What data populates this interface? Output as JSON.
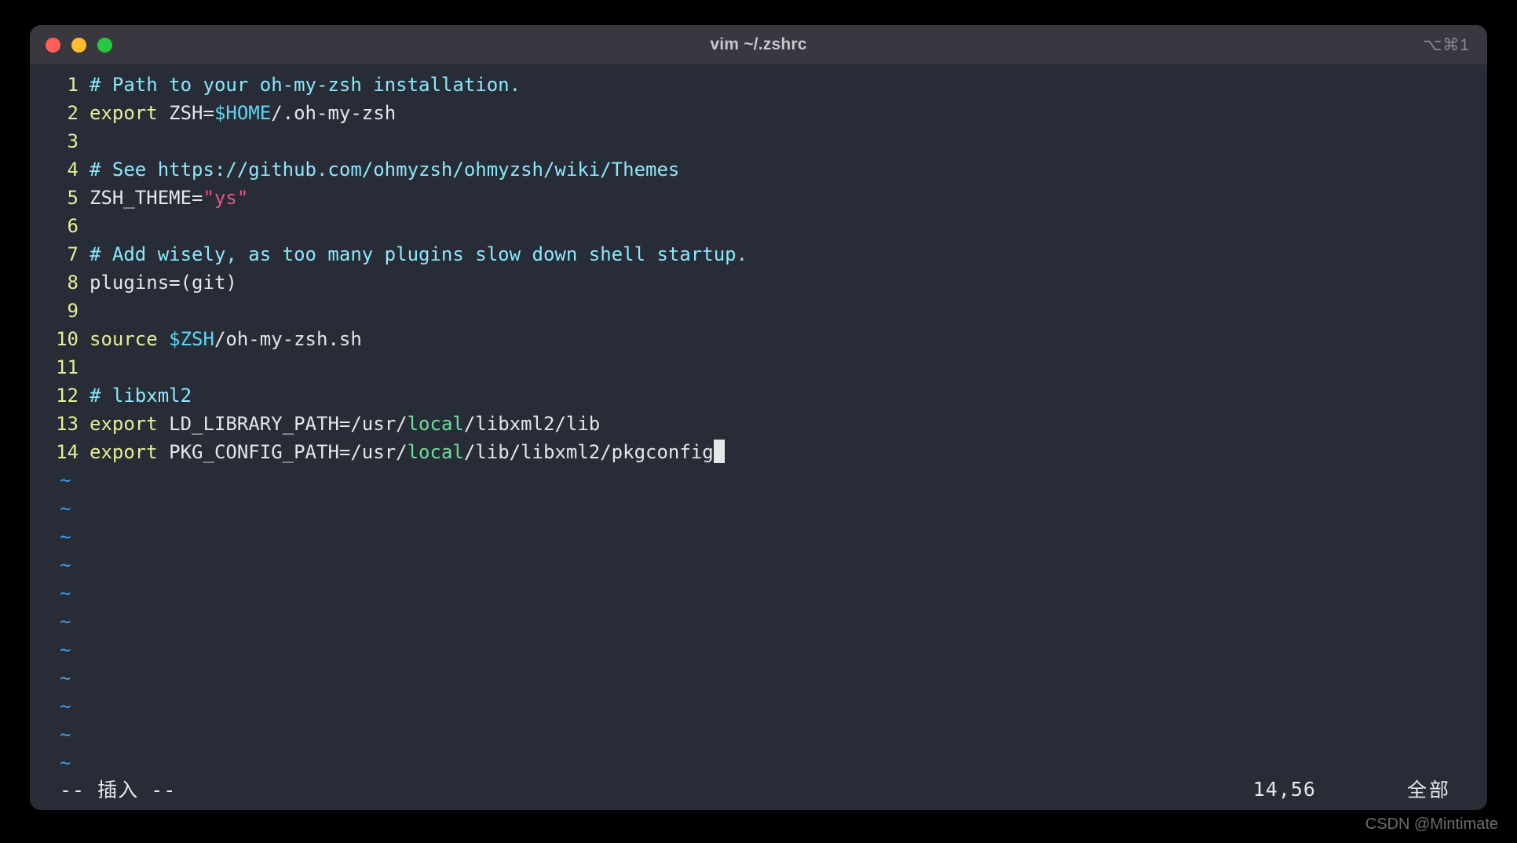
{
  "window": {
    "title": "vim ~/.zshrc",
    "shortcut_hint": "⌥⌘1",
    "traffic_lights": {
      "close_label": "close",
      "minimize_label": "minimize",
      "maximize_label": "maximize",
      "close_color": "#ff5f57",
      "minimize_color": "#febc2e",
      "maximize_color": "#28c840"
    },
    "titlebar_color": "#393740",
    "editor_bg_color": "#282c36"
  },
  "editor": {
    "filename": "~/.zshrc",
    "colors": {
      "line_number": "#e7ee98",
      "comment": "#8be9fd",
      "keyword": "#e7ee98",
      "variable": "#61d6f5",
      "string": "#ee4f8d",
      "directory": "#6cdf9a",
      "plain_text": "#d8dee9",
      "tilde": "#3f9bee",
      "cursor": "#e7e7e7"
    },
    "lines": [
      {
        "number": "1",
        "text": "# Path to your oh-my-zsh installation.",
        "tokens": [
          {
            "t": "# Path to your oh-my-zsh installation.",
            "c": "c-comment"
          }
        ]
      },
      {
        "number": "2",
        "text": "export ZSH=$HOME/.oh-my-zsh",
        "tokens": [
          {
            "t": "export ",
            "c": "c-keyword"
          },
          {
            "t": "ZSH=",
            "c": "c-plain"
          },
          {
            "t": "$HOME",
            "c": "c-var"
          },
          {
            "t": "/.oh-my-zsh",
            "c": "c-plain"
          }
        ]
      },
      {
        "number": "3",
        "text": "",
        "tokens": []
      },
      {
        "number": "4",
        "text": "# See https://github.com/ohmyzsh/ohmyzsh/wiki/Themes",
        "tokens": [
          {
            "t": "# See https://github.com/ohmyzsh/ohmyzsh/wiki/Themes",
            "c": "c-comment"
          }
        ]
      },
      {
        "number": "5",
        "text": "ZSH_THEME=\"ys\"",
        "tokens": [
          {
            "t": "ZSH_THEME=",
            "c": "c-plain"
          },
          {
            "t": "\"ys\"",
            "c": "c-string"
          }
        ]
      },
      {
        "number": "6",
        "text": "",
        "tokens": []
      },
      {
        "number": "7",
        "text": "# Add wisely, as too many plugins slow down shell startup.",
        "tokens": [
          {
            "t": "# Add wisely, as too many plugins slow down shell startup.",
            "c": "c-comment"
          }
        ]
      },
      {
        "number": "8",
        "text": "plugins=(git)",
        "tokens": [
          {
            "t": "plugins=(git)",
            "c": "c-plain"
          }
        ]
      },
      {
        "number": "9",
        "text": "",
        "tokens": []
      },
      {
        "number": "10",
        "text": "source $ZSH/oh-my-zsh.sh",
        "tokens": [
          {
            "t": "source ",
            "c": "c-keyword"
          },
          {
            "t": "$ZSH",
            "c": "c-var"
          },
          {
            "t": "/oh-my-zsh.sh",
            "c": "c-plain"
          }
        ]
      },
      {
        "number": "11",
        "text": "",
        "tokens": []
      },
      {
        "number": "12",
        "text": "# libxml2",
        "tokens": [
          {
            "t": "# libxml2",
            "c": "c-comment"
          }
        ]
      },
      {
        "number": "13",
        "text": "export LD_LIBRARY_PATH=/usr/local/libxml2/lib",
        "tokens": [
          {
            "t": "export ",
            "c": "c-keyword"
          },
          {
            "t": "LD_LIBRARY_PATH=/usr/",
            "c": "c-plain"
          },
          {
            "t": "local",
            "c": "c-dir"
          },
          {
            "t": "/libxml2/lib",
            "c": "c-plain"
          }
        ]
      },
      {
        "number": "14",
        "text": "export PKG_CONFIG_PATH=/usr/local/lib/libxml2/pkgconfig",
        "cursor_at_end": true,
        "tokens": [
          {
            "t": "export ",
            "c": "c-keyword"
          },
          {
            "t": "PKG_CONFIG_PATH=/usr/",
            "c": "c-plain"
          },
          {
            "t": "local",
            "c": "c-dir"
          },
          {
            "t": "/lib/libxml2/pkgconfig",
            "c": "c-plain"
          }
        ]
      }
    ],
    "empty_line_marker": "~",
    "empty_line_count": 11
  },
  "statusline": {
    "mode": "-- 插入 --",
    "position": "14,56",
    "scroll": "全部"
  },
  "watermark": {
    "text": "CSDN @Mintimate"
  }
}
